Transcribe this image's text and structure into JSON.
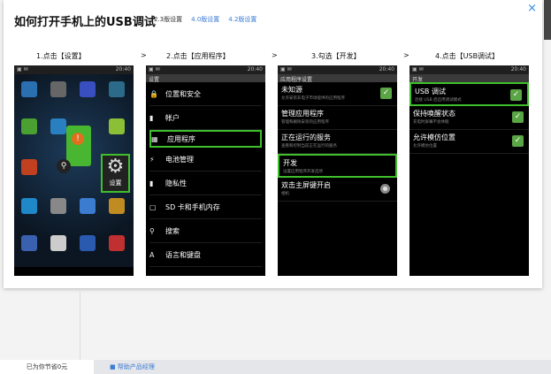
{
  "dialog": {
    "title": "如何打开手机上的USB调试",
    "tabs": [
      "2.3版设置",
      "4.0版设置",
      "4.2版设置"
    ],
    "close": "×"
  },
  "steps": [
    "1.点击【设置】",
    "2.点击【应用程序】",
    "3.勾选【开发】",
    "4.点击【USB调试】"
  ],
  "arrow": ">",
  "phone1": {
    "settings_label": "设置"
  },
  "phone2": {
    "header": "设置",
    "items": [
      {
        "icon": "lock-icon",
        "glyph": "🔒",
        "label": "位置和安全"
      },
      {
        "icon": "account-icon",
        "glyph": "▮",
        "label": "帐户"
      },
      {
        "icon": "apps-icon",
        "glyph": "▦",
        "label": "应用程序"
      },
      {
        "icon": "battery-icon",
        "glyph": "⚡",
        "label": "电池管理"
      },
      {
        "icon": "privacy-icon",
        "glyph": "▮",
        "label": "隐私性"
      },
      {
        "icon": "sdcard-icon",
        "glyph": "▢",
        "label": "SD 卡和手机内存"
      },
      {
        "icon": "search-icon",
        "glyph": "⚲",
        "label": "搜索"
      },
      {
        "icon": "language-icon",
        "glyph": "A",
        "label": "语言和键盘"
      }
    ]
  },
  "phone3": {
    "header": "应用程序设置",
    "items": [
      {
        "title": "未知源",
        "desc": "允许安装非电子市场提供的应用程序",
        "control": "check-on"
      },
      {
        "title": "管理应用程序",
        "desc": "管理和删除安装的应用程序",
        "control": "none"
      },
      {
        "title": "正在运行的服务",
        "desc": "查看和控制当前正在运行的服务",
        "control": "none"
      },
      {
        "title": "开发",
        "desc": "设置应用程序开发选项",
        "control": "none"
      },
      {
        "title": "双击主屏键开启",
        "desc": "相机",
        "control": "radio"
      }
    ]
  },
  "phone4": {
    "header": "开发",
    "items": [
      {
        "title": "USB 调试",
        "desc": "连接 USB 后启用调试模式",
        "control": "check-on"
      },
      {
        "title": "保持唤醒状态",
        "desc": "充电时屏幕不会休眠",
        "control": "check-on"
      },
      {
        "title": "允许模仿位置",
        "desc": "允许模仿位置",
        "control": "check-on"
      }
    ]
  },
  "status_time": "20:40",
  "footer": {
    "saved": "已为你节省0元",
    "feedback": "■ 帮助产品经理"
  },
  "colors": {
    "highlight": "#3fbf2c",
    "link": "#3a7bd5"
  }
}
